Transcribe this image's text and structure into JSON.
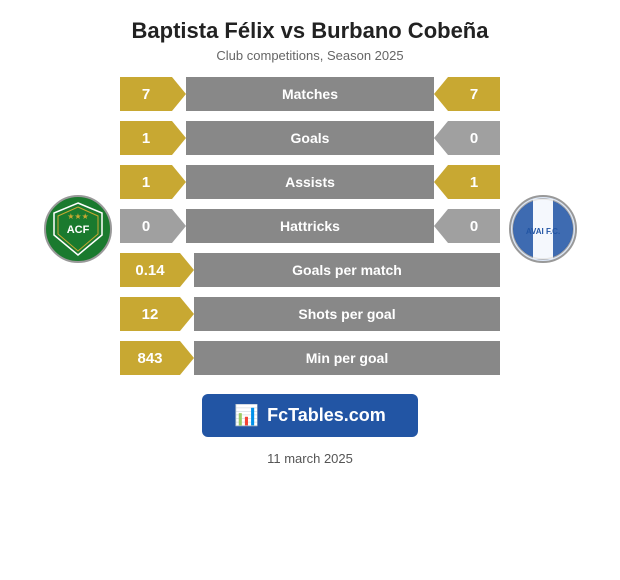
{
  "header": {
    "title": "Baptista Félix vs Burbano Cobeña",
    "subtitle": "Club competitions, Season 2025"
  },
  "stats": [
    {
      "id": "matches",
      "label": "Matches",
      "left": "7",
      "right": "7",
      "leftColor": "gold",
      "rightColor": "gold",
      "single": false
    },
    {
      "id": "goals",
      "label": "Goals",
      "left": "1",
      "right": "0",
      "leftColor": "gold",
      "rightColor": "gray",
      "single": false
    },
    {
      "id": "assists",
      "label": "Assists",
      "left": "1",
      "right": "1",
      "leftColor": "gold",
      "rightColor": "gold",
      "single": false
    },
    {
      "id": "hattricks",
      "label": "Hattricks",
      "left": "0",
      "right": "0",
      "leftColor": "gray",
      "rightColor": "gray",
      "single": false
    }
  ],
  "single_stats": [
    {
      "id": "goals-per-match",
      "label": "Goals per match",
      "value": "0.14"
    },
    {
      "id": "shots-per-goal",
      "label": "Shots per goal",
      "value": "12"
    },
    {
      "id": "min-per-goal",
      "label": "Min per goal",
      "value": "843"
    }
  ],
  "logo_left": {
    "name": "Chapecoense",
    "abbr": "ACF",
    "stars": "★★★"
  },
  "logo_right": {
    "name": "Avai FC",
    "abbr": "AVAI F.C."
  },
  "fctables": {
    "label": "FcTables.com"
  },
  "footer": {
    "date": "11 march 2025"
  }
}
